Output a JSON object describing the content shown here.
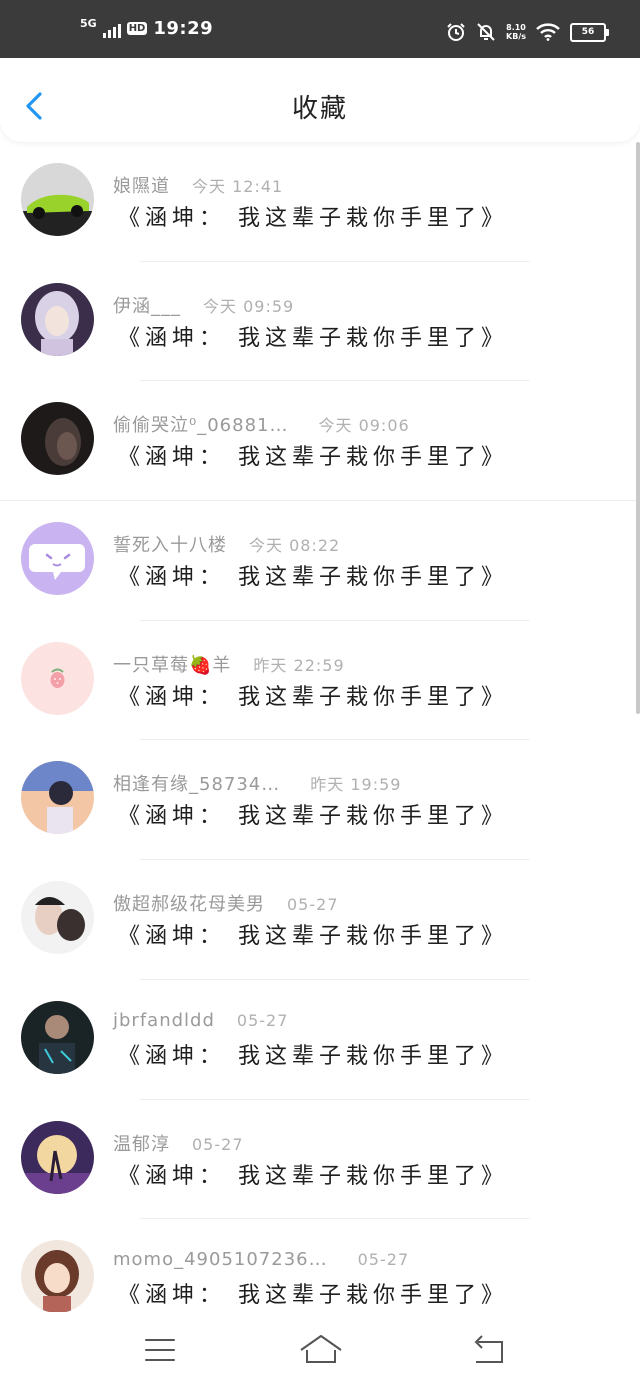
{
  "status_bar": {
    "network": "5G",
    "hd": "HD",
    "time": "19:29",
    "speed": "8.10",
    "speed_unit": "KB/s",
    "battery": "56"
  },
  "header": {
    "title": "收藏",
    "back_icon": "chevron-left-icon"
  },
  "favorites": [
    {
      "name": "娘隰道",
      "time": "今天 12:41",
      "message": "《涵坤： 我这辈子栽你手里了》"
    },
    {
      "name": "伊涵___",
      "time": "今天 09:59",
      "message": "《涵坤： 我这辈子栽你手里了》"
    },
    {
      "name": "偷偷哭泣⁰_06881…",
      "time": "今天 09:06",
      "message": "《涵坤： 我这辈子栽你手里了》"
    },
    {
      "name": "誓死入十八楼",
      "time": "今天 08:22",
      "message": "《涵坤： 我这辈子栽你手里了》"
    },
    {
      "name": "一只草莓🍓羊",
      "time": "昨天 22:59",
      "message": "《涵坤： 我这辈子栽你手里了》"
    },
    {
      "name": "相逢有缘_58734…",
      "time": "昨天 19:59",
      "message": "《涵坤： 我这辈子栽你手里了》"
    },
    {
      "name": "傲超郝级花母美男",
      "time": "05-27",
      "message": "《涵坤： 我这辈子栽你手里了》"
    },
    {
      "name": "jbrfandldd",
      "time": "05-27",
      "message": "《涵坤： 我这辈子栽你手里了》"
    },
    {
      "name": "温郁淳",
      "time": "05-27",
      "message": "《涵坤： 我这辈子栽你手里了》"
    },
    {
      "name": "momo_4905107236…",
      "time": "05-27",
      "message": "《涵坤： 我这辈子栽你手里了》"
    }
  ],
  "nav_bar": {
    "menu_icon": "menu-icon",
    "home_icon": "home-icon",
    "back_icon": "back-icon"
  },
  "colors": {
    "status_bar": "#3b3b3b",
    "accent": "#2196f3",
    "name_text": "#9a9a9a",
    "message_text": "#1f1f1f"
  }
}
